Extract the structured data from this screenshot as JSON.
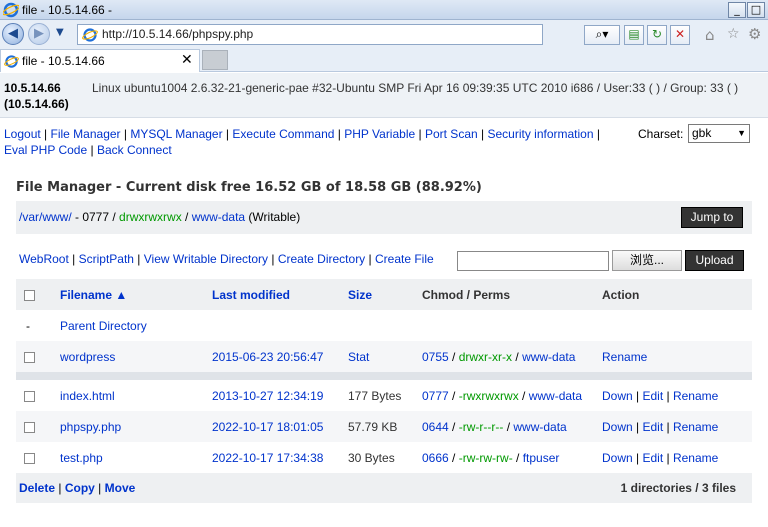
{
  "window": {
    "title": "file - 10.5.14.66 -",
    "minimize": "_",
    "maximize": "□"
  },
  "browser": {
    "url": "http://10.5.14.66/phpspy.php",
    "tab_label": "file - 10.5.14.66",
    "tab_close": "✕"
  },
  "info": {
    "host": "10.5.14.66 (10.5.14.66)",
    "system": "Linux ubuntu1004 2.6.32-21-generic-pae #32-Ubuntu SMP Fri Apr 16 09:39:35 UTC 2010 i686 / User:33 ( ) / Group: 33 ( )"
  },
  "menu": {
    "items": [
      "Logout",
      "File Manager",
      "MYSQL Manager",
      "Execute Command",
      "PHP Variable",
      "Port Scan",
      "Security information",
      "Eval PHP Code",
      "Back Connect"
    ],
    "charset_label": "Charset:",
    "charset_value": "gbk"
  },
  "file_manager": {
    "title": "File Manager - Current disk free 16.52 GB of 18.58 GB (88.92%)",
    "path_link": "/var/www/",
    "path_mode": " - 0777 / ",
    "path_perms": "drwxrwxrwx",
    "path_sep": " / ",
    "path_owner": "www-data",
    "path_writable": " (Writable)",
    "jump_button": "Jump to",
    "links": [
      "WebRoot",
      "ScriptPath",
      "View Writable Directory",
      "Create Directory",
      "Create File"
    ],
    "browse_button": "浏览...",
    "upload_button": "Upload",
    "columns": {
      "filename": "Filename ▲",
      "modified": "Last modified",
      "size": "Size",
      "chmod": "Chmod / Perms",
      "action": "Action"
    },
    "parent_marker": "-",
    "parent_label": "Parent Directory",
    "directories": [
      {
        "name": "wordpress",
        "modified": "2015-06-23 20:56:47",
        "size": "Stat",
        "mode": "0755",
        "perms": "drwxr-xr-x",
        "owner": "www-data",
        "action": "Rename"
      }
    ],
    "files": [
      {
        "name": "index.html",
        "modified": "2013-10-27 12:34:19",
        "size": "177 Bytes",
        "mode": "0777",
        "perms": "-rwxrwxrwx",
        "owner": "www-data",
        "actions": [
          "Down",
          "Edit",
          "Rename"
        ]
      },
      {
        "name": "phpspy.php",
        "modified": "2022-10-17 18:01:05",
        "size": "57.79 KB",
        "mode": "0644",
        "perms": "-rw-r--r--",
        "owner": "www-data",
        "actions": [
          "Down",
          "Edit",
          "Rename"
        ]
      },
      {
        "name": "test.php",
        "modified": "2022-10-17 17:34:38",
        "size": "30 Bytes",
        "mode": "0666",
        "perms": "-rw-rw-rw-",
        "owner": "ftpuser",
        "actions": [
          "Down",
          "Edit",
          "Rename"
        ]
      }
    ],
    "footer_actions": [
      "Delete",
      "Copy",
      "Move"
    ],
    "summary": "1 directories / 3 files"
  },
  "colors": {
    "link": "#0033cc",
    "perms_green": "#009900",
    "button_dark": "#333333"
  }
}
